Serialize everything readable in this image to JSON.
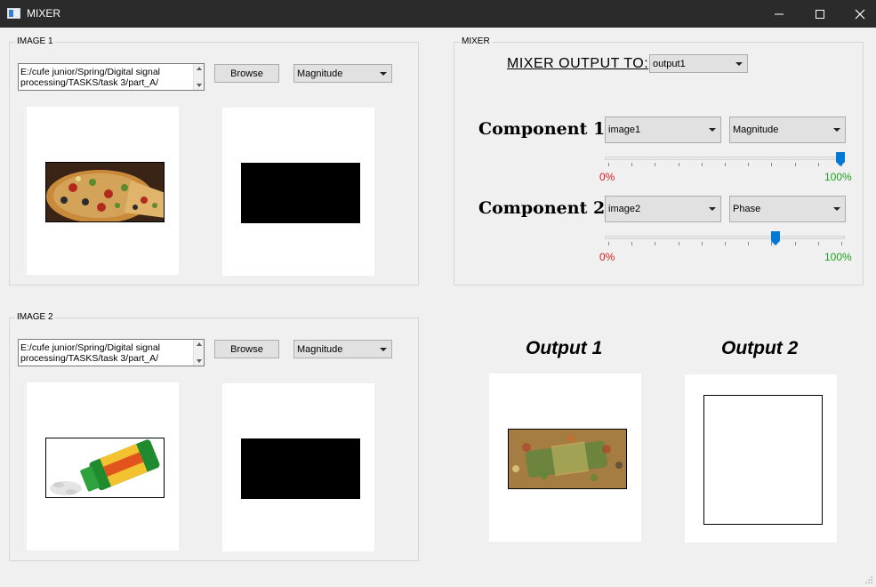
{
  "window": {
    "title": "MIXER"
  },
  "image1": {
    "group_title": "IMAGE 1",
    "path": "E:/cufe junior/Spring/Digital signal processing/TASKS/task 3/part_A/",
    "browse_label": "Browse",
    "component_select": "Magnitude"
  },
  "image2": {
    "group_title": "IMAGE 2",
    "path": "E:/cufe junior/Spring/Digital signal processing/TASKS/task 3/part_A/",
    "browse_label": "Browse",
    "component_select": "Magnitude"
  },
  "mixer": {
    "group_title": "MIXER",
    "output_label": "MIXER OUTPUT TO:",
    "output_select": "output1",
    "component1": {
      "label": "Component 1:",
      "image_select": "image1",
      "type_select": "Magnitude",
      "slider_percent": 100,
      "min_label": "0%",
      "max_label": "100%"
    },
    "component2": {
      "label": "Component 2:",
      "image_select": "image2",
      "type_select": "Phase",
      "slider_percent": 72,
      "min_label": "0%",
      "max_label": "100%"
    }
  },
  "outputs": {
    "output1_title": "Output 1",
    "output2_title": "Output 2"
  },
  "colors": {
    "titlebar": "#2b2b2b",
    "accent_blue": "#0078d7",
    "min_red": "#e01b1b",
    "max_green": "#22a020"
  }
}
